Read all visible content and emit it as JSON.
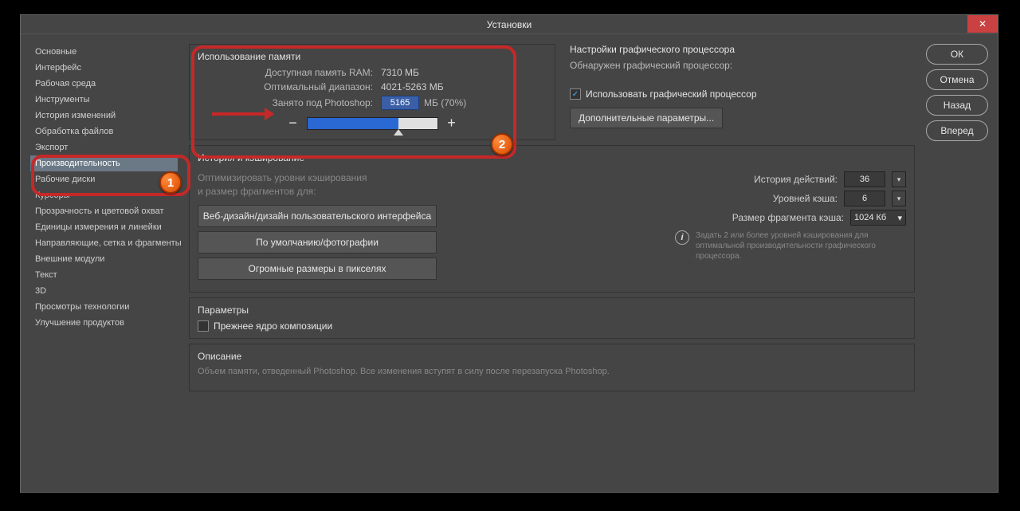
{
  "title": "Установки",
  "sidebar": {
    "items": [
      "Основные",
      "Интерфейс",
      "Рабочая среда",
      "Инструменты",
      "История изменений",
      "Обработка файлов",
      "Экспорт",
      "Производительность",
      "Рабочие диски",
      "Курсоры",
      "Прозрачность и цветовой охват",
      "Единицы измерения и линейки",
      "Направляющие, сетка и фрагменты",
      "Внешние модули",
      "Текст",
      "3D",
      "Просмотры технологии",
      "Улучшение продуктов"
    ],
    "active_index": 7
  },
  "buttons": {
    "ok": "ОК",
    "cancel": "Отмена",
    "back": "Назад",
    "fwd": "Вперед"
  },
  "memory": {
    "title": "Использование памяти",
    "avail_label": "Доступная память RAM:",
    "avail_value": "7310 МБ",
    "range_label": "Оптимальный диапазон:",
    "range_value": "4021-5263 МБ",
    "used_label": "Занято под Photoshop:",
    "used_value": "5165",
    "used_unit": "МБ (70%)",
    "minus": "−",
    "plus": "+"
  },
  "gpu": {
    "title": "Настройки графического процессора",
    "detected": "Обнаружен графический процессор:",
    "use_label": "Использовать графический процессор",
    "use_checked": true,
    "adv_btn": "Дополнительные параметры..."
  },
  "cache": {
    "title": "История и кэширование",
    "hint": "Оптимизировать уровни кэширования\nи размер фрагментов для:",
    "btn1": "Веб-дизайн/дизайн пользовательского интерфейса",
    "btn2": "По умолчанию/фотографии",
    "btn3": "Огромные размеры в пикселях",
    "history_label": "История действий:",
    "history_value": "36",
    "levels_label": "Уровней кэша:",
    "levels_value": "6",
    "tile_label": "Размер фрагмента кэша:",
    "tile_value": "1024 Кб",
    "info": "Задать 2 или более уровней кэширования для оптимальной производительности графического процессора."
  },
  "params": {
    "title": "Параметры",
    "legacy": "Прежнее ядро композиции",
    "legacy_checked": false
  },
  "desc": {
    "title": "Описание",
    "text": "Объем памяти, отведенный Photoshop. Все изменения вступят в силу после перезапуска Photoshop."
  },
  "callouts": {
    "c1": "1",
    "c2": "2"
  }
}
